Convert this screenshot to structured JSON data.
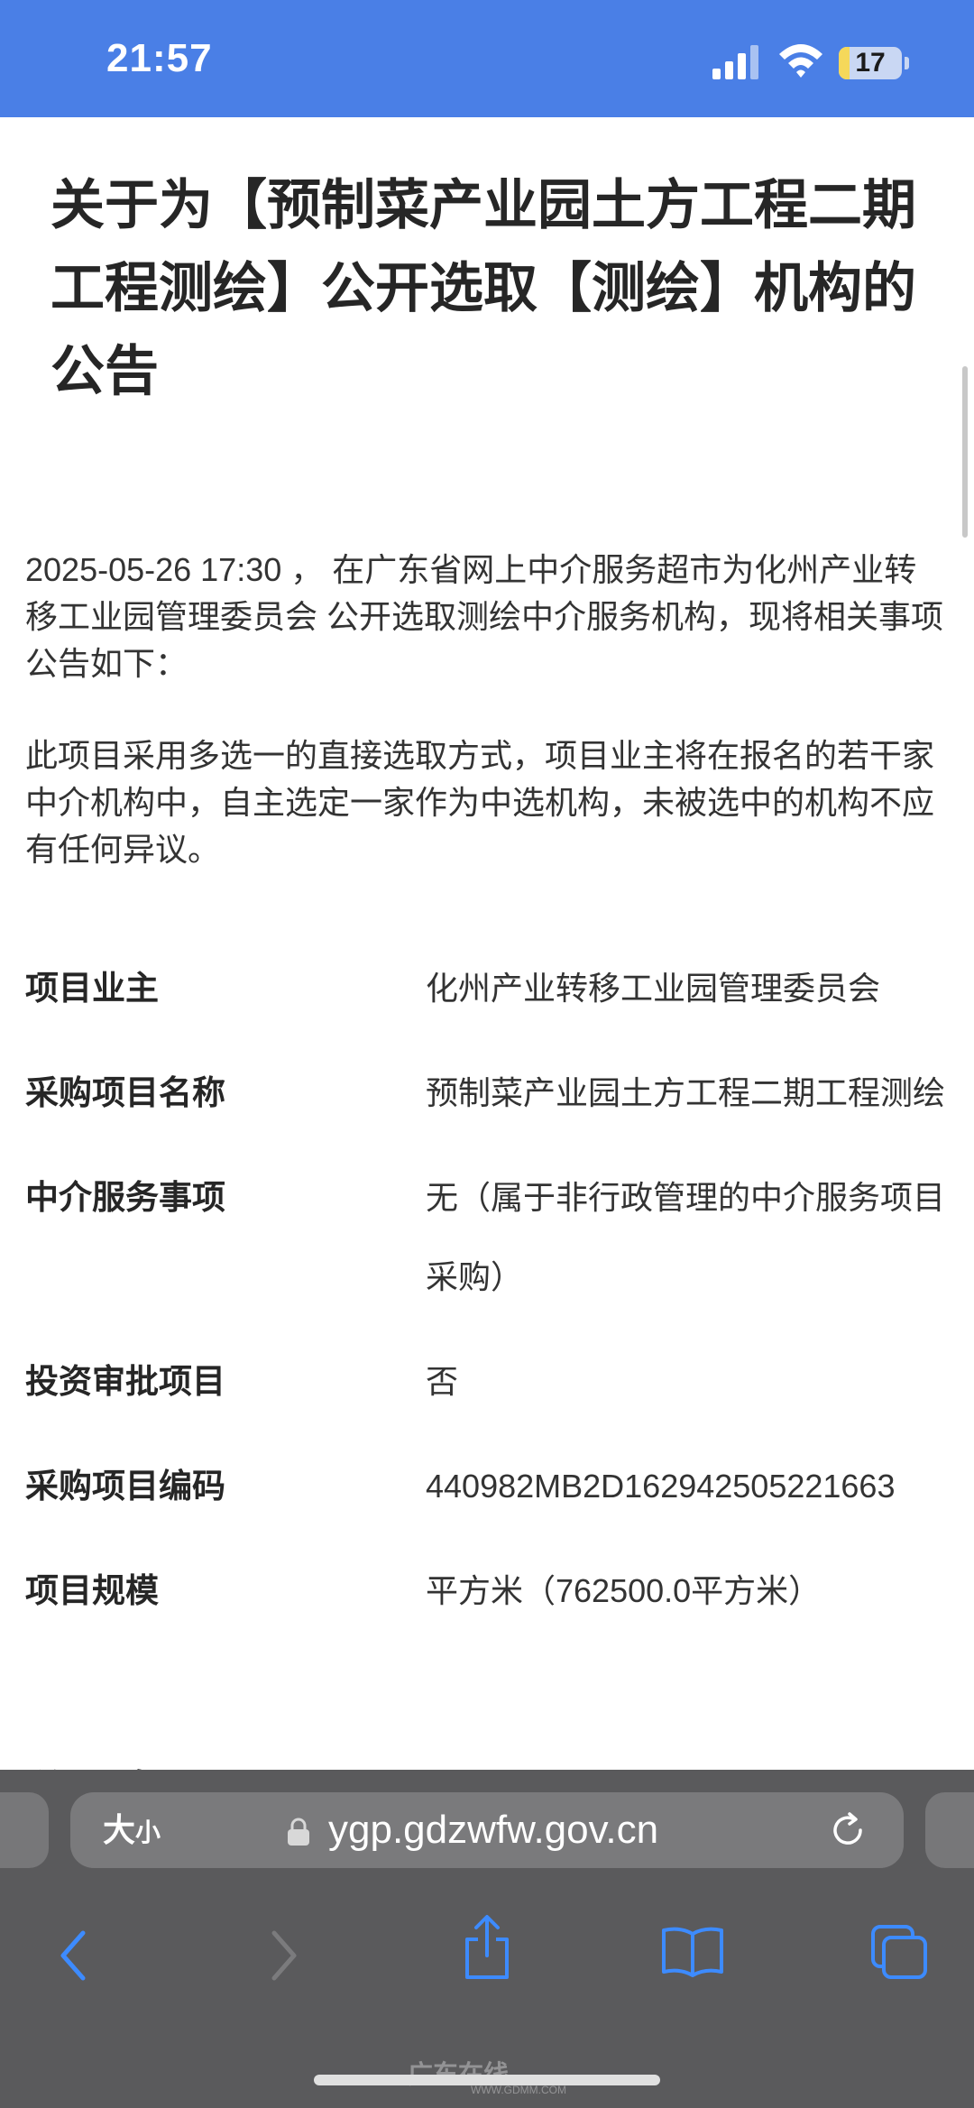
{
  "status_bar": {
    "time": "21:57",
    "battery_level": "17",
    "battery_fraction": 0.17
  },
  "article": {
    "title": "关于为【预制菜产业园土方工程二期工程测绘】公开选取【测绘】机构的公告",
    "paragraph1": "2025-05-26 17:30 ， 在广东省网上中介服务超市为化州产业转移工业园管理委员会 公开选取测绘中介服务机构，现将相关事项公告如下：",
    "paragraph2": "此项目采用多选一的直接选取方式，项目业主将在报名的若干家中介机构中，自主选定一家作为中选机构，未被选中的机构不应有任何异议。",
    "info_rows": [
      {
        "label": "项目业主",
        "value": "化州产业转移工业园管理委员会"
      },
      {
        "label": "采购项目名称",
        "value": "预制菜产业园土方工程二期工程测绘"
      },
      {
        "label": "中介服务事项",
        "value": "无（属于非行政管理的中介服务项目采购）"
      },
      {
        "label": "投资审批项目",
        "value": "否"
      },
      {
        "label": "采购项目编码",
        "value": "440982MB2D162942505221663"
      },
      {
        "label": "项目规模",
        "value": "平方米（762500.0平方米）"
      }
    ],
    "cut_off_heading": "所属服务"
  },
  "browser": {
    "text_size_label": "大",
    "text_size_small": "小",
    "url": "ygp.gdzwfw.gov.cn",
    "icons": {
      "back": "chevron-left-icon",
      "forward": "chevron-right-icon",
      "share": "share-icon",
      "bookmarks": "book-icon",
      "tabs": "tabs-icon",
      "lock": "lock-icon",
      "reload": "reload-icon"
    }
  },
  "watermark": {
    "text": "广东在线",
    "sub": "WWW.GDMM.COM"
  },
  "colors": {
    "status_bar_bg": "#4a7fe6",
    "accent_blue": "#3d8bff",
    "browser_bg": "#5a5a5c",
    "battery_yellow": "#f5d85a"
  }
}
